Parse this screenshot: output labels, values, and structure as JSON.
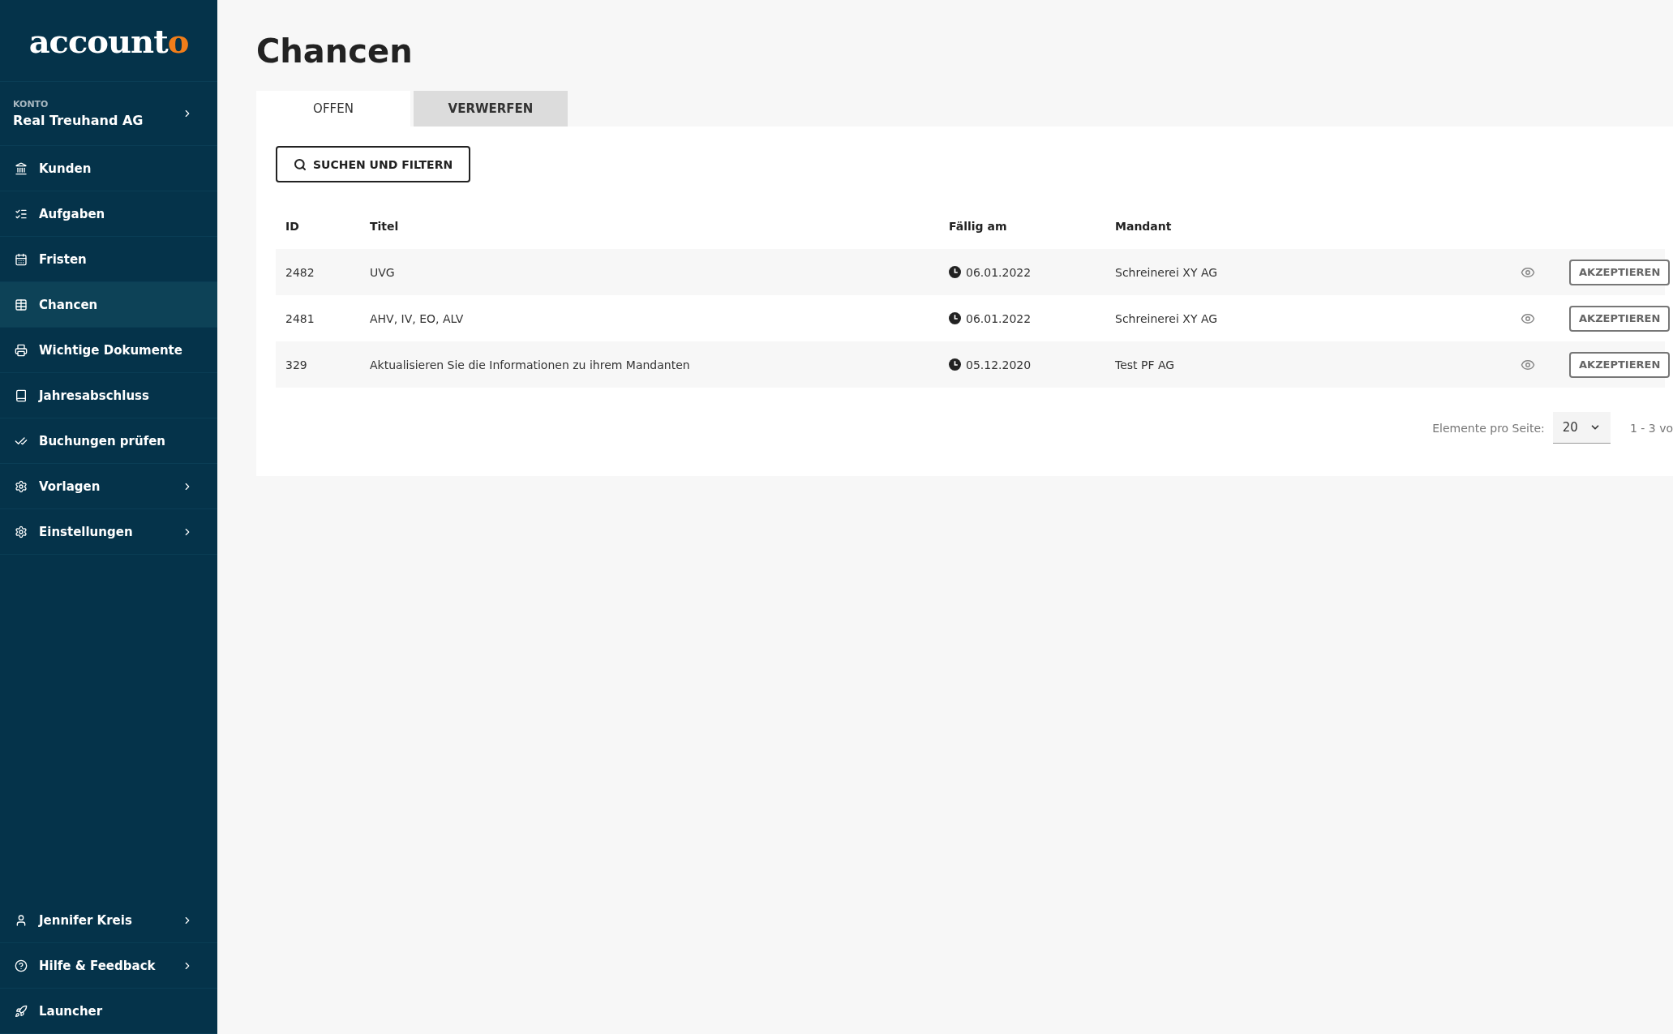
{
  "logo": {
    "text": "account",
    "accent": "o"
  },
  "account": {
    "label": "KONTO",
    "name": "Real Treuhand AG",
    "expandable": true
  },
  "nav": [
    {
      "label": "Kunden",
      "selected": false,
      "expandable": false
    },
    {
      "label": "Aufgaben",
      "selected": false,
      "expandable": false
    },
    {
      "label": "Fristen",
      "selected": false,
      "expandable": false
    },
    {
      "label": "Chancen",
      "selected": true,
      "expandable": false
    },
    {
      "label": "Wichtige Dokumente",
      "selected": false,
      "expandable": false
    },
    {
      "label": "Jahresabschluss",
      "selected": false,
      "expandable": false
    },
    {
      "label": "Buchungen prüfen",
      "selected": false,
      "expandable": false
    },
    {
      "label": "Vorlagen",
      "selected": false,
      "expandable": true
    },
    {
      "label": "Einstellungen",
      "selected": false,
      "expandable": true
    }
  ],
  "nav_bottom": [
    {
      "label": "Jennifer Kreis",
      "selected": false,
      "expandable": true
    },
    {
      "label": "Hilfe & Feedback",
      "selected": false,
      "expandable": true
    },
    {
      "label": "Launcher",
      "selected": false,
      "expandable": false
    }
  ],
  "title": "Chancen",
  "tabs": [
    {
      "label": "OFFEN",
      "selected": true
    },
    {
      "label": "VERWERFEN",
      "selected": false
    }
  ],
  "search_button": "SUCHEN UND FILTERN",
  "table": {
    "columns": [
      "ID",
      "Titel",
      "Fällig am",
      "Mandant"
    ],
    "rows": [
      {
        "id": "2482",
        "title": "UVG",
        "due": "06.01.2022",
        "client": "Schreinerei XY AG",
        "action": "AKZEPTIEREN"
      },
      {
        "id": "2481",
        "title": "AHV, IV, EO, ALV",
        "due": "06.01.2022",
        "client": "Schreinerei XY AG",
        "action": "AKZEPTIEREN"
      },
      {
        "id": "329",
        "title": "Aktualisieren Sie die Informationen zu ihrem Mandanten",
        "due": "05.12.2020",
        "client": "Test PF AG",
        "action": "AKZEPTIEREN"
      }
    ]
  },
  "pagination": {
    "label": "Elemente pro Seite:",
    "page_size": "20",
    "range": "1 - 3 vo"
  }
}
